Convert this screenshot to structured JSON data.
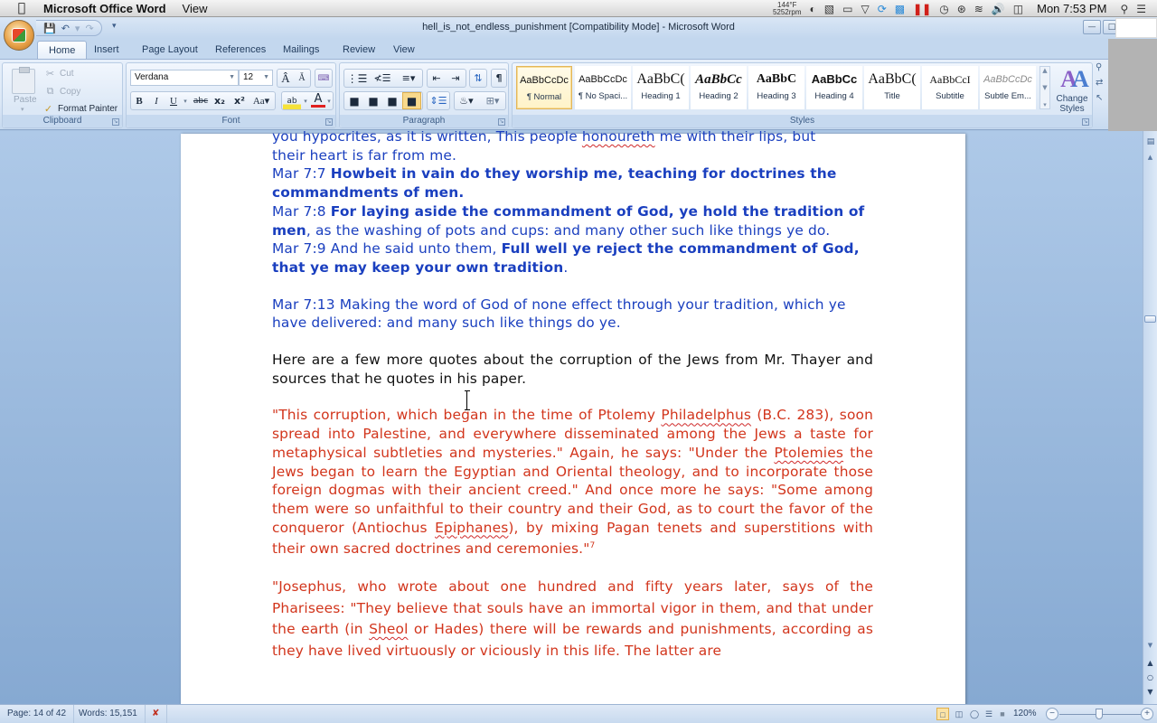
{
  "mac_menubar": {
    "app_name": "Microsoft Office Word",
    "menus": [
      "View"
    ],
    "temp_line1": "144°F",
    "temp_line2": "5252rpm",
    "clock": "Mon 7:53 PM"
  },
  "window": {
    "title": "hell_is_not_endless_punishment [Compatibility Mode] - Microsoft Word"
  },
  "ribbon": {
    "tabs": [
      {
        "label": "Home",
        "active": true
      },
      {
        "label": "Insert"
      },
      {
        "label": "Page Layout"
      },
      {
        "label": "References"
      },
      {
        "label": "Mailings"
      },
      {
        "label": "Review"
      },
      {
        "label": "View"
      }
    ],
    "clipboard": {
      "label": "Clipboard",
      "paste": "Paste",
      "cut": "Cut",
      "copy": "Copy",
      "format_painter": "Format Painter"
    },
    "font": {
      "label": "Font",
      "font_name": "Verdana",
      "font_size": "12"
    },
    "paragraph": {
      "label": "Paragraph"
    },
    "styles": {
      "label": "Styles",
      "items": [
        {
          "sample": "AaBbCcDc",
          "name": "¶ Normal",
          "selected": true
        },
        {
          "sample": "AaBbCcDc",
          "name": "¶ No Spaci..."
        },
        {
          "sample": "AaBbC(",
          "name": "Heading 1"
        },
        {
          "sample": "AaBbCc",
          "name": "Heading 2"
        },
        {
          "sample": "AaBbC",
          "name": "Heading 3"
        },
        {
          "sample": "AaBbCc",
          "name": "Heading 4"
        },
        {
          "sample": "AaBbC(",
          "name": "Title"
        },
        {
          "sample": "AaBbCcI",
          "name": "Subtitle"
        },
        {
          "sample": "AaBbCcDc",
          "name": "Subtle Em..."
        }
      ],
      "change_styles": "Change Styles"
    }
  },
  "document": {
    "lines": {
      "l1": "you hypocrites, as it is written, This people ",
      "l1_sq": "honoureth",
      "l1_end": " me with their lips, but",
      "l2": "their heart is far from me.",
      "v7_ref": "Mar 7:7  ",
      "v7_bold": "Howbeit in vain do they worship me, teaching for doctrines the commandments of men.",
      "v8_ref": "Mar 7:8  ",
      "v8_bold": "For laying aside the commandment of God, ye hold the tradition of men",
      "v8_rest": ", as the washing of pots and cups: and many other such like things ye do.",
      "v9_ref": "Mar 7:9  ",
      "v9_plain": "And he said unto them, ",
      "v9_bold": "Full well ye reject the commandment of God, that ye may keep your own tradition",
      "v9_end": ".",
      "v13": "Mar 7:13  Making the word of God of none effect through your tradition, which ye have delivered: and many such like things do ye.",
      "intro": "Here are a few more quotes about the corruption of the Jews from Mr. Thayer and sources that he quotes in his paper.",
      "q1_a": "\"This corruption, which began in the time of Ptolemy ",
      "q1_sq1": "Philadelphus",
      "q1_b": " (B.C. 283), soon spread into Palestine, and everywhere disseminated among the Jews a taste for metaphysical subtleties and mysteries.\" Again, he says: \"Under the ",
      "q1_sq2": "Ptolemies",
      "q1_c": " the Jews began to learn the Egyptian and Oriental theology, and to incorporate those foreign dogmas with their ancient creed.\" And once more he says: \"Some among them were so unfaithful to their country and their God, as to court the favor of the conqueror (Antiochus ",
      "q1_sq3": "Epiphanes",
      "q1_d": "), by mixing Pagan tenets and superstitions with their own sacred doctrines and ceremonies.\"",
      "q1_note": "7",
      "q2_a": "\"Josephus, who wrote about one hundred and fifty years later, says of the Pharisees: \"They believe that souls have an immortal vigor in them, and that under the earth (in ",
      "q2_sq": "Sheol",
      "q2_b": " or Hades) there will be rewards and punishments, according as they have lived virtuously or viciously in this life. The latter are"
    }
  },
  "statusbar": {
    "page": "Page: 14 of 42",
    "words": "Words: 15,151",
    "zoom": "120%"
  },
  "colors": {
    "scripture_blue": "#1a3fbf",
    "quote_red": "#d2351c",
    "ribbon_bg": "#dbe7f6"
  }
}
